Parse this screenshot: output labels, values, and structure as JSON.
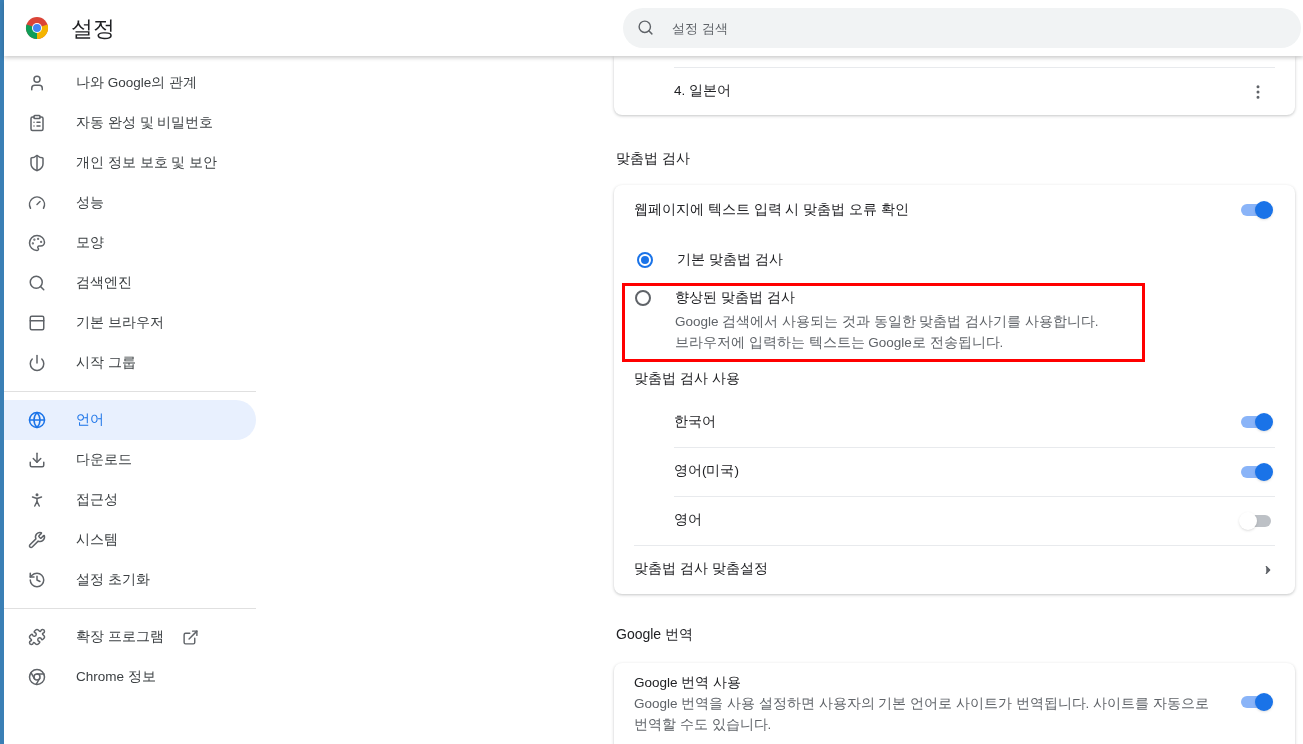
{
  "header": {
    "title": "설정",
    "search": {
      "placeholder": "설정 검색"
    }
  },
  "sidebar": {
    "groups": [
      [
        {
          "label": "나와 Google의 관계",
          "kind": "person",
          "selected": false
        },
        {
          "label": "자동 완성 및 비밀번호",
          "kind": "clipboard",
          "selected": false
        },
        {
          "label": "개인 정보 보호 및 보안",
          "kind": "shield",
          "selected": false
        },
        {
          "label": "성능",
          "kind": "gauge",
          "selected": false
        },
        {
          "label": "모양",
          "kind": "palette",
          "selected": false
        },
        {
          "label": "검색엔진",
          "kind": "search",
          "selected": false
        },
        {
          "label": "기본 브라우저",
          "kind": "browser",
          "selected": false
        },
        {
          "label": "시작 그룹",
          "kind": "power",
          "selected": false
        }
      ],
      [
        {
          "label": "언어",
          "kind": "globe",
          "selected": true
        },
        {
          "label": "다운로드",
          "kind": "download",
          "selected": false
        },
        {
          "label": "접근성",
          "kind": "accessibility",
          "selected": false
        },
        {
          "label": "시스템",
          "kind": "wrench",
          "selected": false
        },
        {
          "label": "설정 초기화",
          "kind": "history",
          "selected": false
        }
      ],
      [
        {
          "label": "확장 프로그램",
          "kind": "puzzle",
          "selected": false,
          "external": true
        },
        {
          "label": "Chrome 정보",
          "kind": "chrome",
          "selected": false,
          "external": false
        }
      ]
    ]
  },
  "languages_card": {
    "rows": [
      {
        "label": "4. 일본어"
      }
    ]
  },
  "spellcheck": {
    "heading": "맞춤법 검사",
    "toggle": {
      "label": "웹페이지에 텍스트 입력 시 맞춤법 오류 확인",
      "on": true
    },
    "options": [
      {
        "label": "기본 맞춤법 검사",
        "selected": true,
        "highlighted": false
      },
      {
        "label": "향상된 맞춤법 검사",
        "description": "Google 검색에서 사용되는 것과 동일한 맞춤법 검사기를 사용합니다. 브라우저에 입력하는 텍스트는 Google로 전송됩니다.",
        "selected": false,
        "highlighted": true
      }
    ],
    "use_heading": "맞춤법 검사 사용",
    "languages": [
      {
        "label": "한국어",
        "on": true
      },
      {
        "label": "영어(미국)",
        "on": true
      },
      {
        "label": "영어",
        "on": false
      }
    ],
    "customize": "맞춤법 검사 맞춤설정"
  },
  "translate": {
    "heading": "Google 번역",
    "toggle": {
      "label": "Google 번역 사용",
      "description": "Google 번역을 사용 설정하면 사용자의 기본 언어로 사이트가 번역됩니다. 사이트를 자동으로 번역할 수도 있습니다.",
      "on": true
    }
  }
}
